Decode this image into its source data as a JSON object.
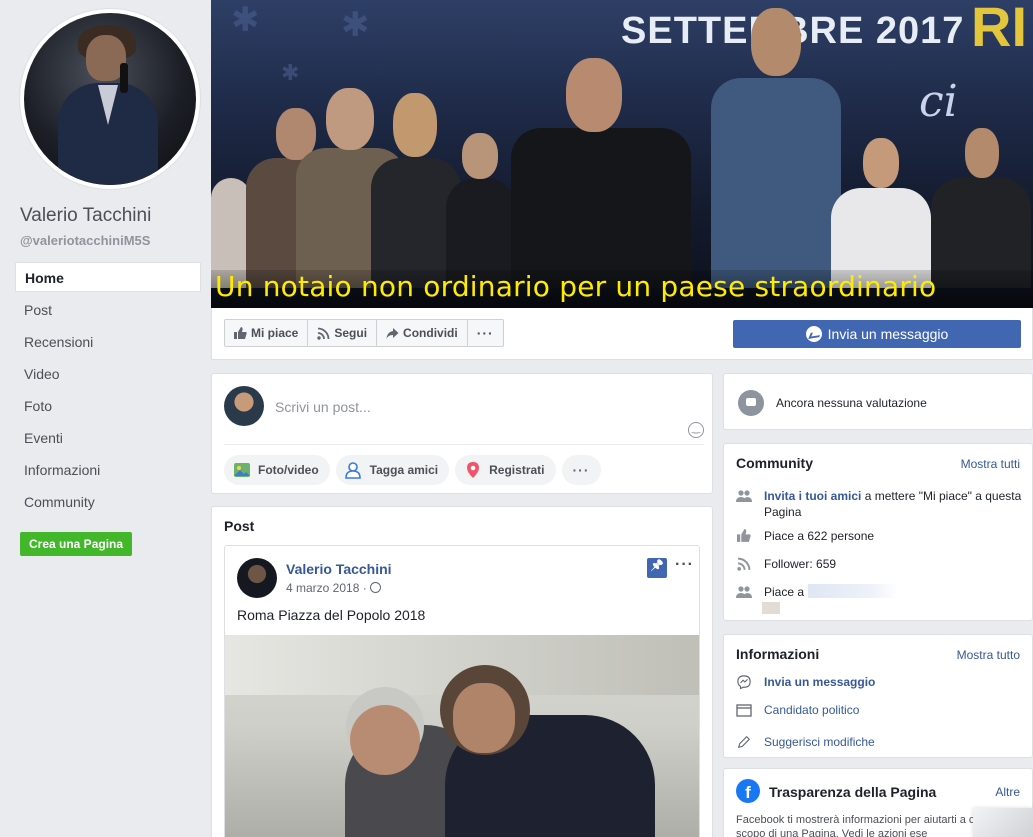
{
  "sidebar": {
    "page_name": "Valerio Tacchini",
    "handle": "@valeriotacchiniM5S",
    "nav": [
      {
        "label": "Home"
      },
      {
        "label": "Post"
      },
      {
        "label": "Recensioni"
      },
      {
        "label": "Video"
      },
      {
        "label": "Foto"
      },
      {
        "label": "Eventi"
      },
      {
        "label": "Informazioni"
      },
      {
        "label": "Community"
      }
    ],
    "create_page_label": "Crea una Pagina"
  },
  "cover": {
    "banner_text": "SETTEMBRE 2017",
    "banner_text_right": "RI",
    "banner_script": "ci",
    "caption": "Un notaio non ordinario per un paese straordinario",
    "caption_color": "#ffeb00"
  },
  "action_bar": {
    "like_label": "Mi piace",
    "follow_label": "Segui",
    "share_label": "Condividi",
    "more_label": "···",
    "message_label": "Invia un messaggio",
    "message_color": "#4267b2"
  },
  "composer": {
    "placeholder": "Scrivi un post...",
    "actions": [
      {
        "label": "Foto/video",
        "icon": "photo-icon"
      },
      {
        "label": "Tagga amici",
        "icon": "tag-friends-icon"
      },
      {
        "label": "Registrati",
        "icon": "location-pin-icon"
      }
    ],
    "more_label": "···"
  },
  "posts": {
    "title": "Post",
    "items": [
      {
        "author": "Valerio Tacchini",
        "date": "4 marzo 2018 ·",
        "text": "Roma Piazza del Popolo 2018",
        "more_label": "···"
      }
    ]
  },
  "ratings": {
    "text": "Ancora nessuna valutazione"
  },
  "community": {
    "title": "Community",
    "see_all": "Mostra tutti",
    "invite_link": "Invita i tuoi amici",
    "invite_rest": " a mettere \"Mi piace\" a questa Pagina",
    "likes": "Piace a 622 persone",
    "followers": "Follower: 659",
    "liked_by": "Piace a"
  },
  "informazioni": {
    "title": "Informazioni",
    "see_all": "Mostra tutto",
    "send_message": "Invia un messaggio",
    "category": "Candidato politico",
    "suggest_edits": "Suggerisci modifiche"
  },
  "transparency": {
    "title": "Trasparenza della Pagina",
    "more_link": "Altre",
    "description": "Facebook ti mostrerà informazioni per aiutarti a c meglio lo scopo di una Pagina. Vedi le azioni ese",
    "logo_letter": "f"
  }
}
